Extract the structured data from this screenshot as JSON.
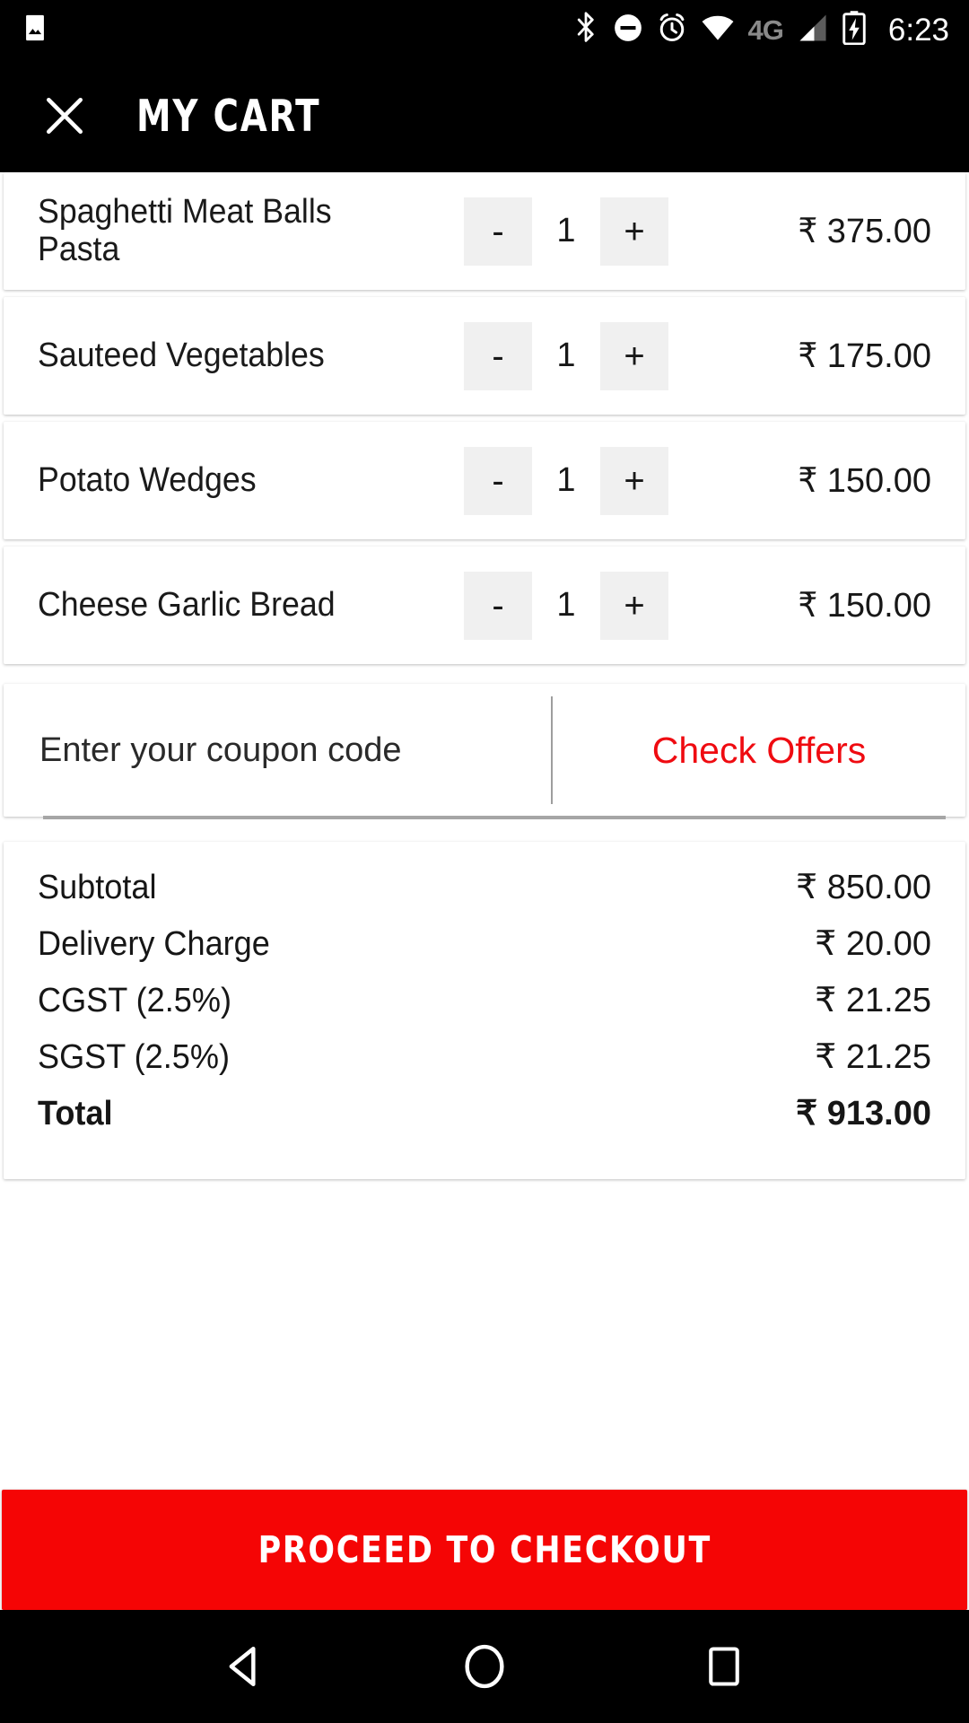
{
  "status_bar": {
    "left_icons": [
      {
        "name": "image-icon",
        "label": "image"
      }
    ],
    "right_icons": [
      {
        "name": "bluetooth-icon",
        "label": "bluetooth"
      },
      {
        "name": "do-not-disturb-icon",
        "label": "do not disturb"
      },
      {
        "name": "alarm-icon",
        "label": "alarm"
      },
      {
        "name": "wifi-icon",
        "label": "wifi"
      },
      {
        "name": "network-type",
        "label": "4G"
      },
      {
        "name": "signal-icon",
        "label": "signal"
      },
      {
        "name": "battery-charging-icon",
        "label": "battery charging"
      }
    ],
    "network_type": "4G",
    "time": "6:23"
  },
  "app_bar": {
    "close_label": "×",
    "title": "My Cart"
  },
  "cart": {
    "items": [
      {
        "name": "Spaghetti Meat Balls Pasta",
        "decrement_label": "-",
        "quantity": "1",
        "increment_label": "+",
        "currency": "₹",
        "price": "375.00"
      },
      {
        "name": "Sauteed Vegetables",
        "decrement_label": "-",
        "quantity": "1",
        "increment_label": "+",
        "currency": "₹",
        "price": "175.00"
      },
      {
        "name": "Potato Wedges",
        "decrement_label": "-",
        "quantity": "1",
        "increment_label": "+",
        "currency": "₹",
        "price": "150.00"
      },
      {
        "name": "Cheese Garlic Bread",
        "decrement_label": "-",
        "quantity": "1",
        "increment_label": "+",
        "currency": "₹",
        "price": "150.00"
      }
    ]
  },
  "coupon": {
    "placeholder": "Enter your coupon code",
    "value": "",
    "check_offers_label": "Check Offers"
  },
  "summary": {
    "rows": [
      {
        "label": "Subtotal",
        "value": "₹ 850.00"
      },
      {
        "label": "Delivery Charge",
        "value": "₹ 20.00"
      },
      {
        "label": "CGST (2.5%)",
        "value": "₹ 21.25"
      },
      {
        "label": "SGST (2.5%)",
        "value": "₹ 21.25"
      }
    ],
    "total": {
      "label": "Total",
      "value": "₹ 913.00"
    }
  },
  "checkout": {
    "label": "Proceed to Checkout"
  },
  "nav_bar": {
    "back_label": "back",
    "home_label": "home",
    "recents_label": "recents"
  },
  "colors": {
    "accent_red": "#f50505",
    "offer_red": "#ef0b11",
    "bar_black": "#000000",
    "stepper_gray": "#f0f0f0"
  }
}
